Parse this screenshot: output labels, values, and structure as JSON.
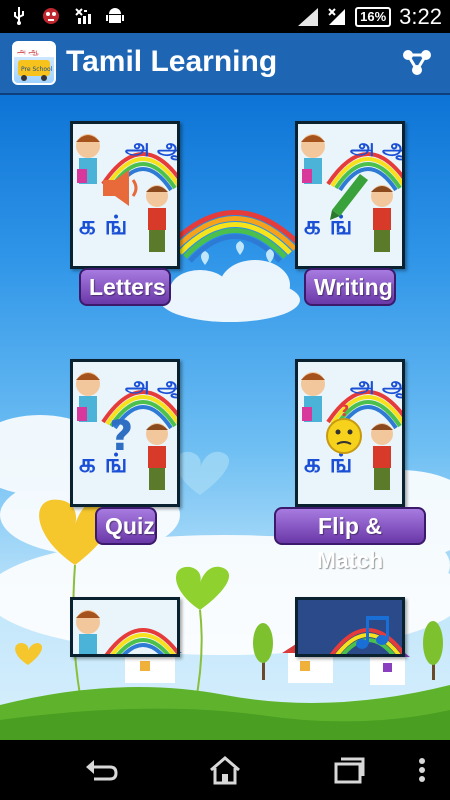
{
  "status_bar": {
    "time": "3:22",
    "battery": "16%",
    "icons": [
      "usb-icon",
      "notification-icon",
      "signal-off-icon",
      "android-icon",
      "wifi-icon",
      "signal-icon",
      "charging-icon"
    ]
  },
  "action_bar": {
    "title": "Tamil Learning",
    "logo_text": "Pre School",
    "share_icon": "share-icon"
  },
  "menu": {
    "letters": "Letters",
    "writing": "Writing",
    "quiz": "Quiz",
    "flip_match": "Flip & Match"
  },
  "tile_glyphs": {
    "top": "அ ஆ",
    "bottom": "க ங்"
  },
  "nav_bar": {
    "icons": [
      "back-icon",
      "home-icon",
      "recents-icon",
      "menu-icon"
    ]
  },
  "colors": {
    "action_bar": "#1e66b4",
    "label_bg": "#7d4cc1",
    "sky": "#2f95e8"
  }
}
